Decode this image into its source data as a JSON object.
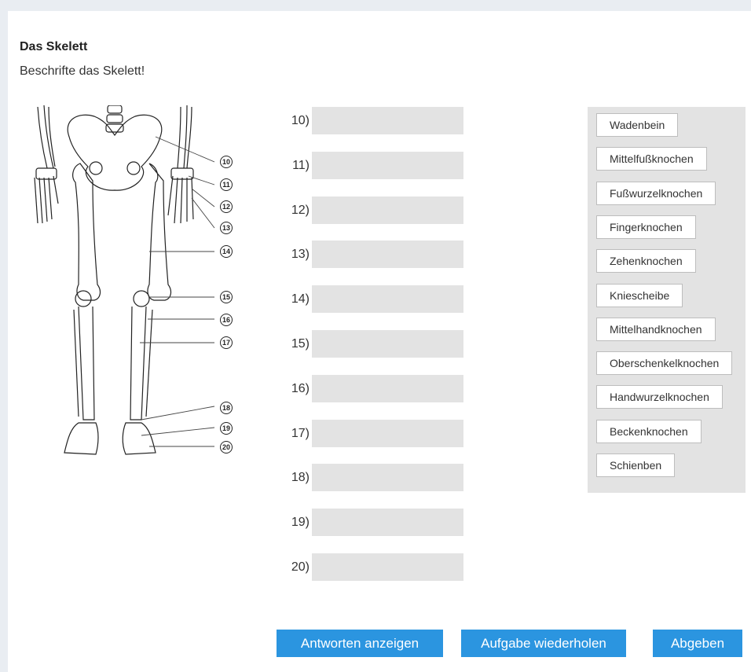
{
  "task": {
    "title": "Das Skelett",
    "instruction": "Beschrifte das Skelett!"
  },
  "diagram": {
    "markers": [
      "10",
      "11",
      "12",
      "13",
      "14",
      "15",
      "16",
      "17",
      "18",
      "19",
      "20"
    ]
  },
  "answers": [
    {
      "label": "10)",
      "value": ""
    },
    {
      "label": "11)",
      "value": ""
    },
    {
      "label": "12)",
      "value": ""
    },
    {
      "label": "13)",
      "value": ""
    },
    {
      "label": "14)",
      "value": ""
    },
    {
      "label": "15)",
      "value": ""
    },
    {
      "label": "16)",
      "value": ""
    },
    {
      "label": "17)",
      "value": ""
    },
    {
      "label": "18)",
      "value": ""
    },
    {
      "label": "19)",
      "value": ""
    },
    {
      "label": "20)",
      "value": ""
    }
  ],
  "word_bank": [
    "Wadenbein",
    "Mittelfußknochen",
    "Fußwurzelknochen",
    "Fingerknochen",
    "Zehenknochen",
    "Kniescheibe",
    "Mittelhandknochen",
    "Oberschenkelknochen",
    "Handwurzelknochen",
    "Beckenknochen",
    "Schienben"
  ],
  "buttons": {
    "show_answers": "Antworten anzeigen",
    "retry": "Aufgabe wiederholen",
    "submit": "Abgeben"
  },
  "colors": {
    "button": "#2b95e0",
    "drop_zone": "#e3e3e3",
    "word_bank_bg": "#e3e3e3"
  }
}
